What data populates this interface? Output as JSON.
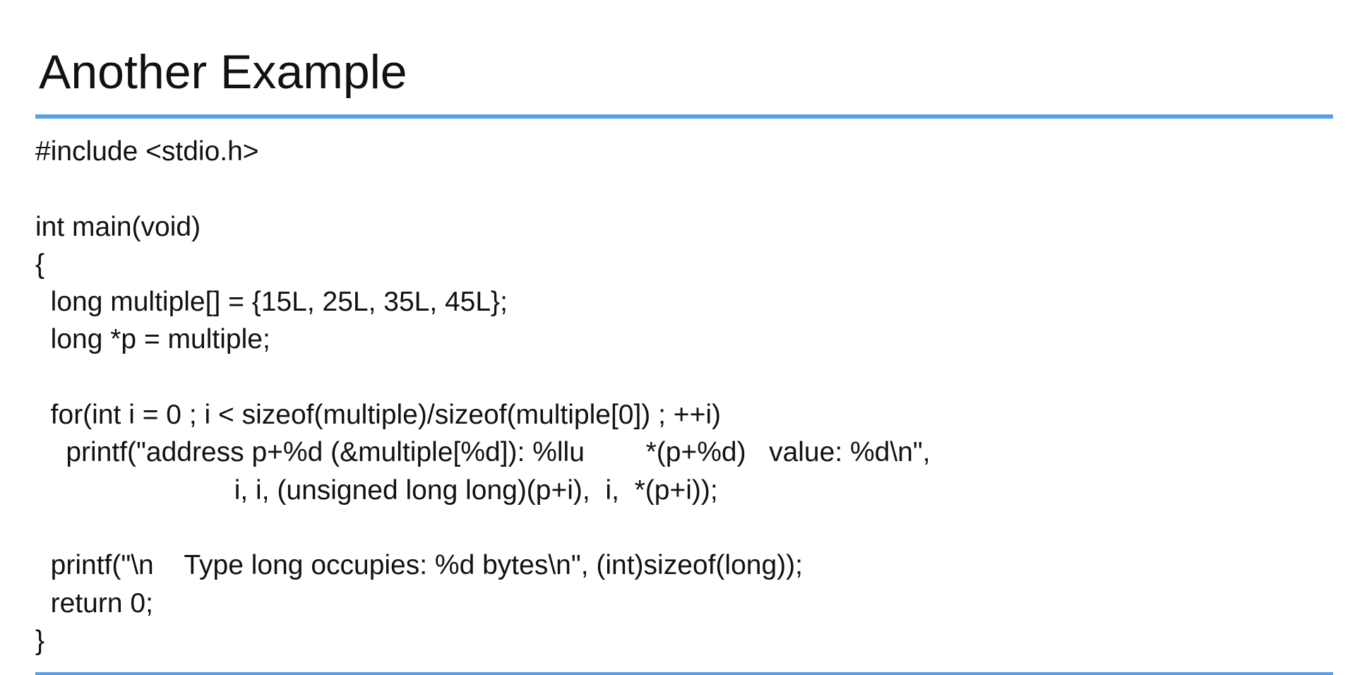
{
  "slide": {
    "title": "Another Example",
    "accent_color": "#5a9ee6",
    "code_lines": [
      "#include <stdio.h>",
      "",
      "int main(void)",
      "{",
      "  long multiple[] = {15L, 25L, 35L, 45L};",
      "  long *p = multiple;",
      "",
      "  for(int i = 0 ; i < sizeof(multiple)/sizeof(multiple[0]) ; ++i)",
      "    printf(\"address p+%d (&multiple[%d]): %llu        *(p+%d)   value: %d\\n\",",
      "                          i, i, (unsigned long long)(p+i),  i,  *(p+i));",
      "",
      "  printf(\"\\n    Type long occupies: %d bytes\\n\", (int)sizeof(long));",
      "  return 0;",
      "}"
    ]
  }
}
